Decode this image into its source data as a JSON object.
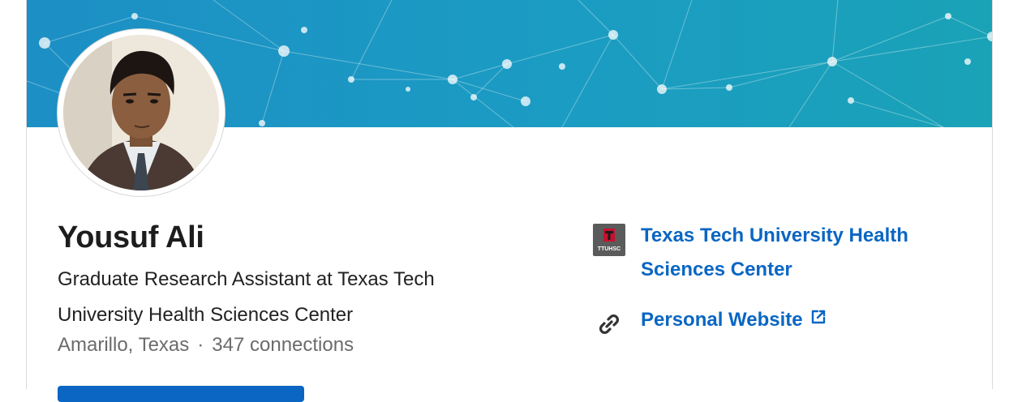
{
  "profile": {
    "name": "Yousuf Ali",
    "headline": "Graduate Research Assistant at Texas Tech University Health Sciences Center",
    "location": "Amarillo, Texas",
    "separator": "·",
    "connections": "347 connections"
  },
  "sidebar": {
    "organization": {
      "name": "Texas Tech University Health Sciences Center",
      "logo_text": "TTUHSC",
      "logo_icon": "ttuhsc-logo-icon"
    },
    "website": {
      "label": "Personal Website",
      "link_icon": "link-chain-icon",
      "external_icon": "external-link-icon"
    }
  },
  "colors": {
    "accent": "#0a66c2",
    "banner": "#1b9cc3",
    "text_primary": "#1d1d1d",
    "text_secondary": "#6b6b6b"
  }
}
